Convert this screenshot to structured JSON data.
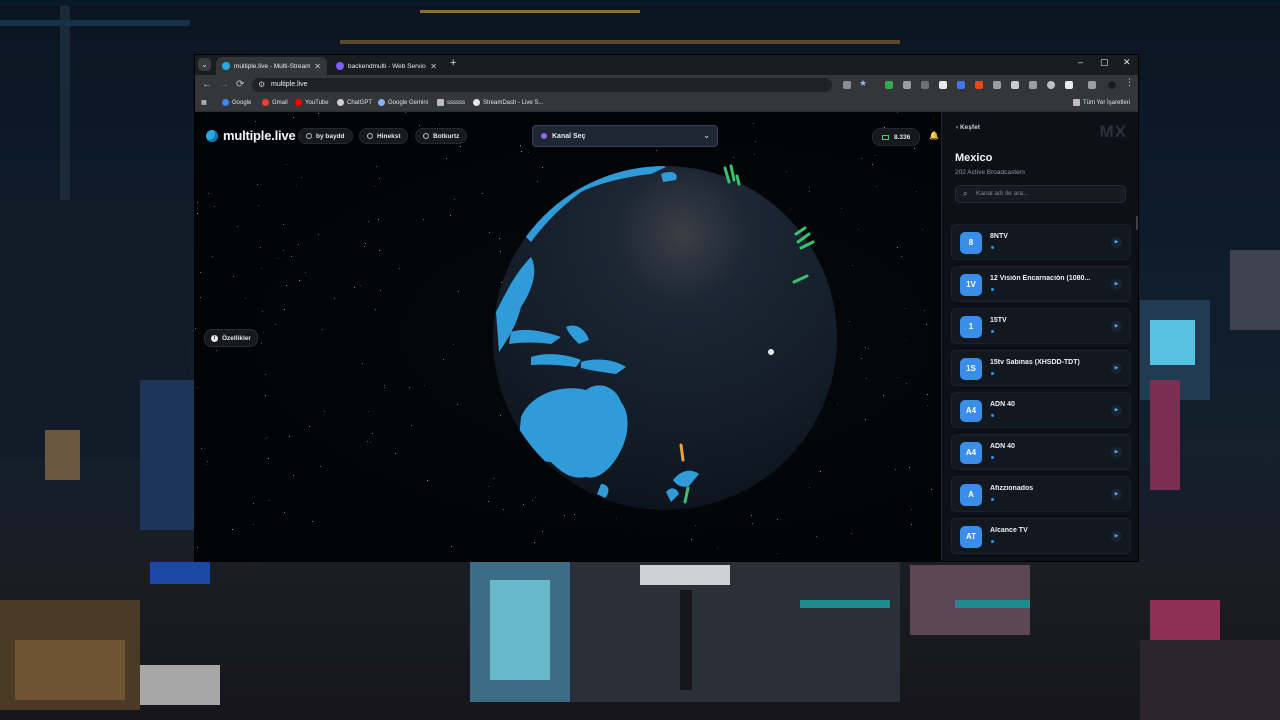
{
  "browser": {
    "tabs": [
      {
        "title": "multiple.live - Multi-Stream De",
        "active": true,
        "favicon_color": "#2aa8e6"
      },
      {
        "title": "backendmulti - Web Service - R",
        "active": false,
        "favicon_color": "#7b5cff"
      }
    ],
    "new_tab": "+",
    "tab_search": "⌄",
    "close_tab": "✕",
    "window_controls": {
      "minimize": "–",
      "maximize": "▢",
      "close": "✕"
    },
    "nav": {
      "back": "←",
      "forward": "→",
      "reload": "⟳"
    },
    "url": "multiple.live",
    "bookmarks": [
      {
        "label": "Google",
        "color": "#4285f4"
      },
      {
        "label": "Gmail",
        "color": "#ea4335"
      },
      {
        "label": "YouTube",
        "color": "#ff0000"
      },
      {
        "label": "ChatGPT",
        "color": "#d0d0d0"
      },
      {
        "label": "Google Gemini",
        "color": "#8ab4f8"
      },
      {
        "label": "ssssss",
        "color": "#bdbdbd"
      },
      {
        "label": "StreamDash - Live S...",
        "color": "#e6e6e6"
      }
    ],
    "all_bookmarks": "Tüm Yer İşaretleri"
  },
  "app": {
    "brand": "multiple.live",
    "nav_pills": [
      "by baydd",
      "Hinekst",
      "Botkurtz"
    ],
    "channel_select": "Kanal Seç",
    "viewer_count": "8.336",
    "features_label": "Özellikler",
    "accent": "#2aa8e6"
  },
  "panel": {
    "back_label": "Keşfet",
    "country_code": "MX",
    "country": "Mexico",
    "broadcasters": "202 Active Broadcasters",
    "search_placeholder": "Kanal adı ile ara...",
    "channels": [
      {
        "badge": "8",
        "name": "8NTV"
      },
      {
        "badge": "1V",
        "name": "12 Visión Encarnación (1080..."
      },
      {
        "badge": "1",
        "name": "15TV"
      },
      {
        "badge": "1S",
        "name": "15tv Sabinas (XHSDD-TDT)"
      },
      {
        "badge": "A4",
        "name": "ADN 40"
      },
      {
        "badge": "A4",
        "name": "ADN 40"
      },
      {
        "badge": "A",
        "name": "Afizzionados"
      },
      {
        "badge": "AT",
        "name": "Alcance TV"
      }
    ]
  }
}
